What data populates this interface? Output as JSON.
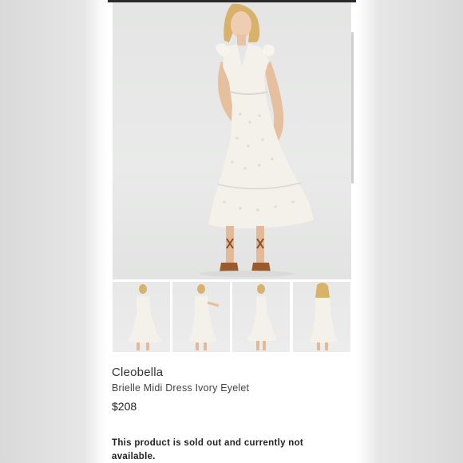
{
  "product": {
    "brand": "Cleobella",
    "name": "Brielle Midi Dress Ivory Eyelet",
    "price": "$208",
    "availability": "This product is sold out and currently not available."
  },
  "gallery": {
    "main_image": "model-wearing-ivory-eyelet-dress-front",
    "thumbnails": [
      "dress-front-view",
      "dress-front-pose",
      "dress-side-view",
      "dress-back-view"
    ]
  },
  "colors": {
    "background": "#ffffff",
    "dress": "#f4f1ea",
    "backdrop": "#e6e7e6",
    "text": "#333333"
  }
}
